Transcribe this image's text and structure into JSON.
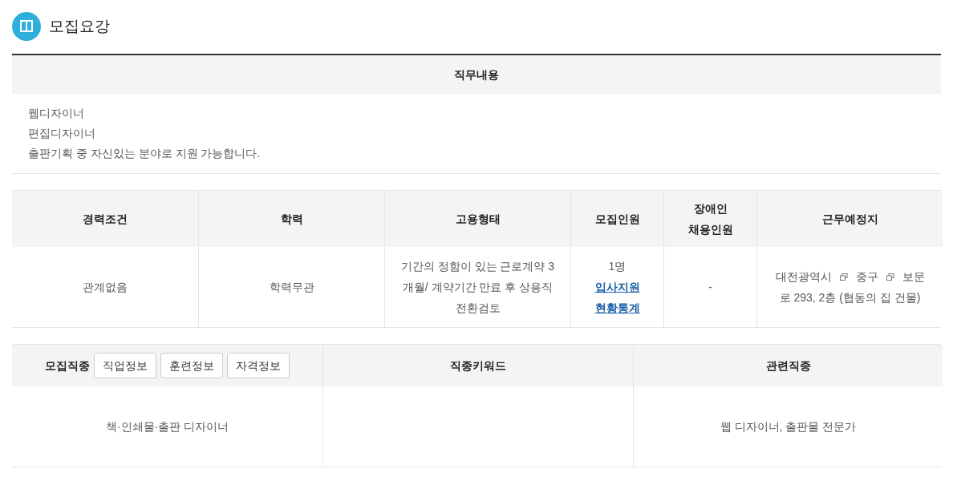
{
  "section_title": "모집요강",
  "duty": {
    "header": "직무내용",
    "lines": [
      "웹디자이너",
      "편집디자이너",
      "출판기획 중 자신있는 분야로 지원 가능합니다."
    ]
  },
  "conditions": {
    "columns": [
      "경력조건",
      "학력",
      "고용형태",
      "모집인원",
      "장애인\n채용인원",
      "근무예정지"
    ],
    "experience": "관계없음",
    "education": "학력무관",
    "employment": "기간의 정함이 있는 근로계약 3개월/ 계약기간 만료 후 상용직 전환검토",
    "headcount": {
      "value": "1명",
      "links": [
        "입사지원",
        "현황통계"
      ]
    },
    "disabled_hiring": "-",
    "location": [
      {
        "text": "대전광역시",
        "kind": "link"
      },
      {
        "text": "중구",
        "kind": "link"
      },
      {
        "text": "보문",
        "kind": "plain"
      },
      {
        "text": "로 293, 2층 (협동의 집 건물)",
        "kind": "line"
      }
    ]
  },
  "jobs": {
    "label": "모집직종",
    "buttons": [
      "직업정보",
      "훈련정보",
      "자격정보"
    ],
    "columns": [
      "직종키워드",
      "관련직종"
    ],
    "category": "책·인쇄물·출판 디자이너",
    "related": "웹 디자이너, 출판물 전문가"
  }
}
